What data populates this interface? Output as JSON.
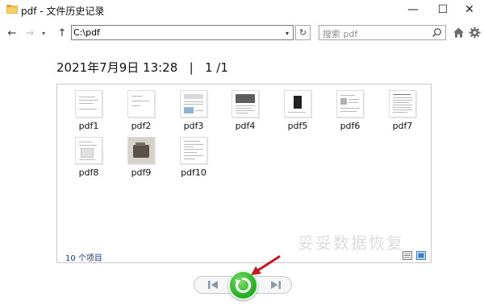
{
  "window": {
    "title": "pdf - 文件历史记录",
    "minimize_glyph": "—",
    "maximize_glyph": "☐",
    "close_glyph": "✕"
  },
  "nav": {
    "back_glyph": "←",
    "forward_glyph": "→",
    "history_glyph": "▾",
    "up_glyph": "↑",
    "address": "C:\\pdf",
    "address_drop_glyph": "▾",
    "refresh_glyph": "↻",
    "search_placeholder": "搜索 pdf"
  },
  "heading": {
    "date": "2021年7月9日 13:28",
    "separator": "|",
    "page": "1 /1"
  },
  "files": [
    {
      "label": "pdf1",
      "icon": "document-thumbnail-icon"
    },
    {
      "label": "pdf2",
      "icon": "document-thumbnail-icon"
    },
    {
      "label": "pdf3",
      "icon": "document-thumbnail-icon"
    },
    {
      "label": "pdf4",
      "icon": "document-thumbnail-icon"
    },
    {
      "label": "pdf5",
      "icon": "document-thumbnail-icon"
    },
    {
      "label": "pdf6",
      "icon": "document-thumbnail-icon"
    },
    {
      "label": "pdf7",
      "icon": "document-thumbnail-icon"
    },
    {
      "label": "pdf8",
      "icon": "document-thumbnail-icon"
    },
    {
      "label": "pdf9",
      "icon": "photo-thumbnail-icon"
    },
    {
      "label": "pdf10",
      "icon": "document-thumbnail-icon"
    }
  ],
  "status": {
    "item_count": "10 个项目"
  },
  "watermark": "妥妥数据恢复",
  "controls": {
    "previous_icon": "previous-version-icon",
    "restore_icon": "restore-icon",
    "next_icon": "next-version-icon"
  },
  "colors": {
    "restore_green": "#2fb82a",
    "annotation_red": "#c8171e",
    "status_blue": "#1a3a8a"
  }
}
